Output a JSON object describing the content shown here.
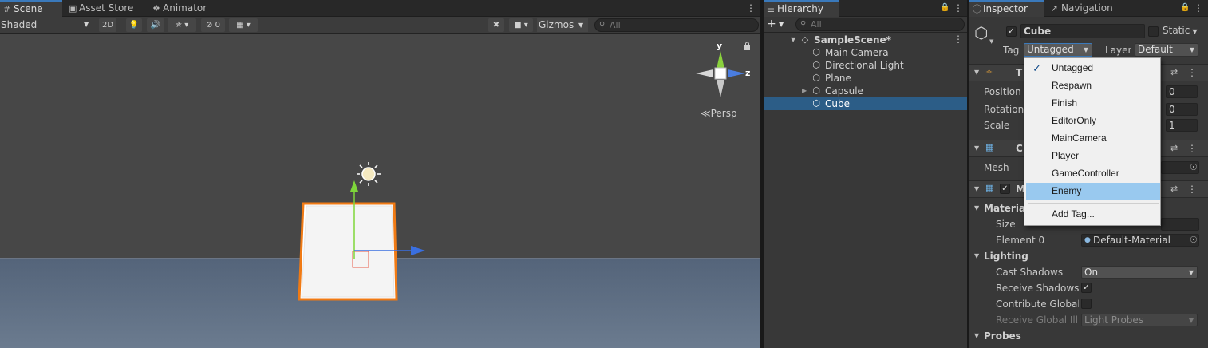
{
  "scene_panel": {
    "tabs": [
      {
        "label": "Scene",
        "icon": "grid-hash-icon"
      },
      {
        "label": "Asset Store",
        "icon": "shopping-bag-icon"
      },
      {
        "label": "Animator",
        "icon": "animator-icon"
      }
    ],
    "toolbar": {
      "shading_mode": "Shaded",
      "mode_2d": "2D",
      "hidden_count": "0",
      "gizmos_label": "Gizmos",
      "search_placeholder": "All"
    },
    "gizmo": {
      "y_label": "y",
      "z_label": "z",
      "projection_label": "Persp"
    }
  },
  "hierarchy": {
    "tab_label": "Hierarchy",
    "search_placeholder": "All",
    "scene_name": "SampleScene*",
    "items": [
      {
        "label": "Main Camera",
        "icon": "gameobject-cube-icon",
        "selected": false,
        "expandable": false
      },
      {
        "label": "Directional Light",
        "icon": "gameobject-cube-icon",
        "selected": false,
        "expandable": false
      },
      {
        "label": "Plane",
        "icon": "gameobject-cube-icon",
        "selected": false,
        "expandable": false
      },
      {
        "label": "Capsule",
        "icon": "gameobject-cube-icon",
        "selected": false,
        "expandable": true
      },
      {
        "label": "Cube",
        "icon": "gameobject-cube-icon",
        "selected": true,
        "expandable": false
      }
    ]
  },
  "inspector": {
    "tabs": [
      {
        "label": "Inspector",
        "icon": "info-icon"
      },
      {
        "label": "Navigation",
        "icon": "navigation-icon"
      }
    ],
    "object_name": "Cube",
    "static_label": "Static",
    "tag_label": "Tag",
    "tag_value": "Untagged",
    "layer_label": "Layer",
    "layer_value": "Default",
    "transform": {
      "header": "T",
      "position_label": "Position",
      "rotation_label": "Rotation",
      "scale_label": "Scale",
      "position_z": "0",
      "rotation_z": "0",
      "scale_z": "1"
    },
    "mesh_filter": {
      "header": "C",
      "mesh_label": "Mesh"
    },
    "mesh_renderer": {
      "header": "M",
      "materials_label": "Material",
      "size_label": "Size",
      "element0_label": "Element 0",
      "element0_value": "Default-Material",
      "lighting_label": "Lighting",
      "cast_shadows_label": "Cast Shadows",
      "cast_shadows_value": "On",
      "receive_shadows_label": "Receive Shadows",
      "contribute_gi_label": "Contribute Global I",
      "receive_gi_label": "Receive Global Illu",
      "receive_gi_value": "Light Probes",
      "probes_label": "Probes"
    }
  },
  "tag_menu": {
    "items": [
      {
        "label": "Untagged",
        "checked": true,
        "highlighted": false
      },
      {
        "label": "Respawn",
        "checked": false,
        "highlighted": false
      },
      {
        "label": "Finish",
        "checked": false,
        "highlighted": false
      },
      {
        "label": "EditorOnly",
        "checked": false,
        "highlighted": false
      },
      {
        "label": "MainCamera",
        "checked": false,
        "highlighted": false
      },
      {
        "label": "Player",
        "checked": false,
        "highlighted": false
      },
      {
        "label": "GameController",
        "checked": false,
        "highlighted": false
      },
      {
        "label": "Enemy",
        "checked": false,
        "highlighted": true
      }
    ],
    "add_tag_label": "Add Tag..."
  },
  "colors": {
    "selection_blue": "#2c5d87",
    "menu_highlight": "#99c9ef",
    "cube_outline": "#f07a14",
    "axis_x": "#3a6fe0",
    "axis_y": "#7ed63a"
  }
}
